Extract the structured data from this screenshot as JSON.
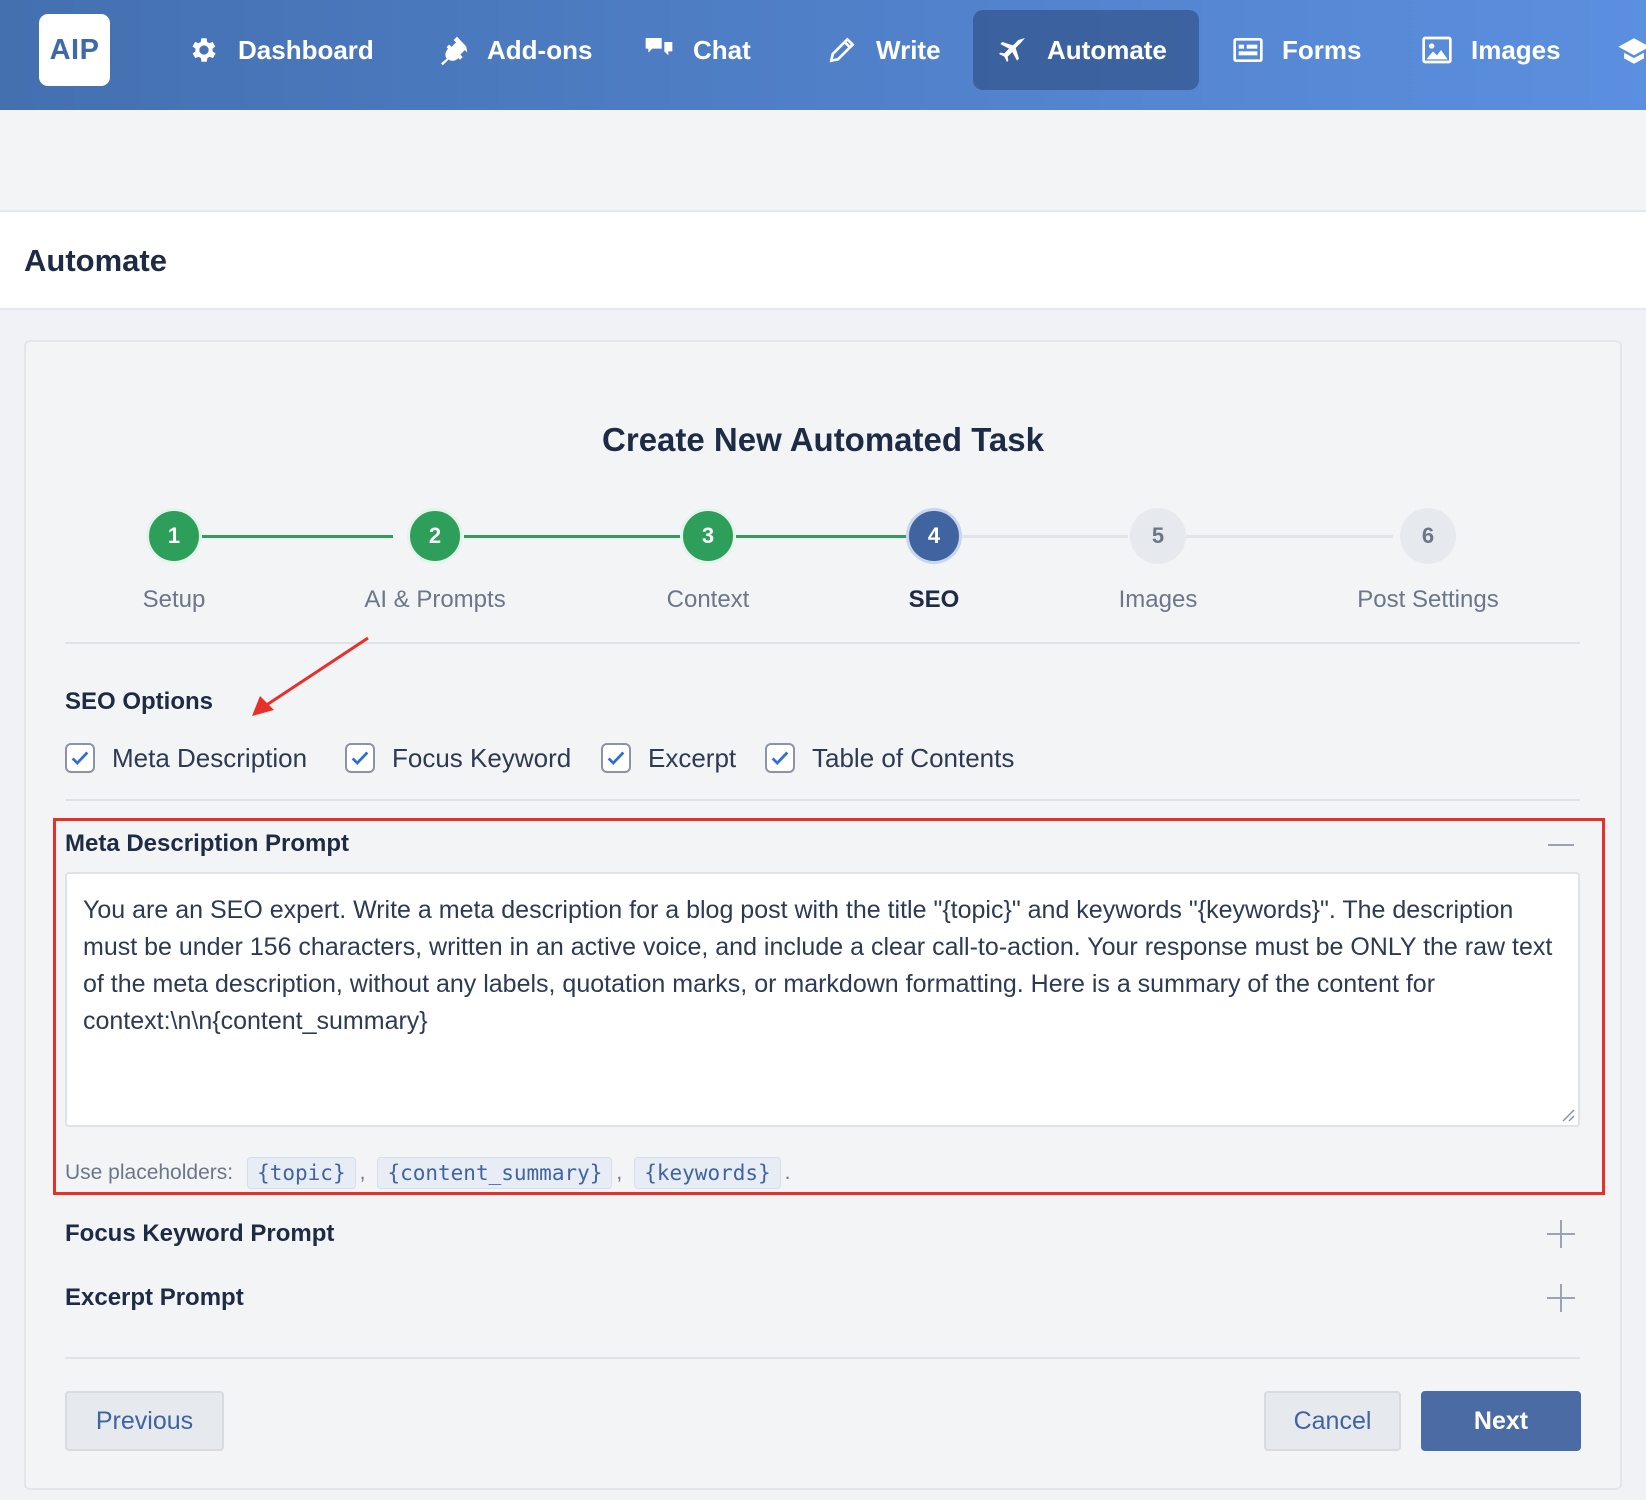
{
  "app": {
    "logo_text": "AIP"
  },
  "nav": {
    "items": [
      {
        "label": "Dashboard",
        "icon": "gear-icon",
        "active": false
      },
      {
        "label": "Add-ons",
        "icon": "plug-icon",
        "active": false
      },
      {
        "label": "Chat",
        "icon": "chat-icon",
        "active": false
      },
      {
        "label": "Write",
        "icon": "pencil-icon",
        "active": false
      },
      {
        "label": "Automate",
        "icon": "plane-icon",
        "active": true
      },
      {
        "label": "Forms",
        "icon": "form-icon",
        "active": false
      },
      {
        "label": "Images",
        "icon": "image-icon",
        "active": false
      }
    ],
    "overflow_icon": "graduation-cap-icon"
  },
  "page": {
    "title": "Automate"
  },
  "wizard": {
    "title": "Create New Automated Task",
    "current_step": 4,
    "steps": [
      {
        "number": "1",
        "label": "Setup",
        "status": "done"
      },
      {
        "number": "2",
        "label": "AI & Prompts",
        "status": "done"
      },
      {
        "number": "3",
        "label": "Context",
        "status": "done"
      },
      {
        "number": "4",
        "label": "SEO",
        "status": "current"
      },
      {
        "number": "5",
        "label": "Images",
        "status": "todo"
      },
      {
        "number": "6",
        "label": "Post Settings",
        "status": "todo"
      }
    ]
  },
  "seo": {
    "options_label": "SEO Options",
    "options": [
      {
        "label": "Meta Description",
        "checked": true
      },
      {
        "label": "Focus Keyword",
        "checked": true
      },
      {
        "label": "Excerpt",
        "checked": true
      },
      {
        "label": "Table of Contents",
        "checked": true
      }
    ],
    "meta_prompt": {
      "label": "Meta Description Prompt",
      "expanded": true,
      "value": "You are an SEO expert. Write a meta description for a blog post with the title \"{topic}\" and keywords \"{keywords}\". The description must be under 156 characters, written in an active voice, and include a clear call-to-action. Your response must be ONLY the raw text of the meta description, without any labels, quotation marks, or markdown formatting. Here is a summary of the content for context:\\n\\n{content_summary}",
      "hint_prefix": "Use placeholders:",
      "placeholders": [
        "{topic}",
        "{content_summary}",
        "{keywords}"
      ],
      "separator": ",",
      "hint_suffix": "."
    },
    "focus_prompt": {
      "label": "Focus Keyword Prompt",
      "expanded": false
    },
    "excerpt_prompt": {
      "label": "Excerpt Prompt",
      "expanded": false
    }
  },
  "actions": {
    "previous": "Previous",
    "cancel": "Cancel",
    "next": "Next"
  },
  "colors": {
    "accent": "#4a6ba3",
    "done": "#2e9e5b",
    "annotation": "#e8302a"
  }
}
